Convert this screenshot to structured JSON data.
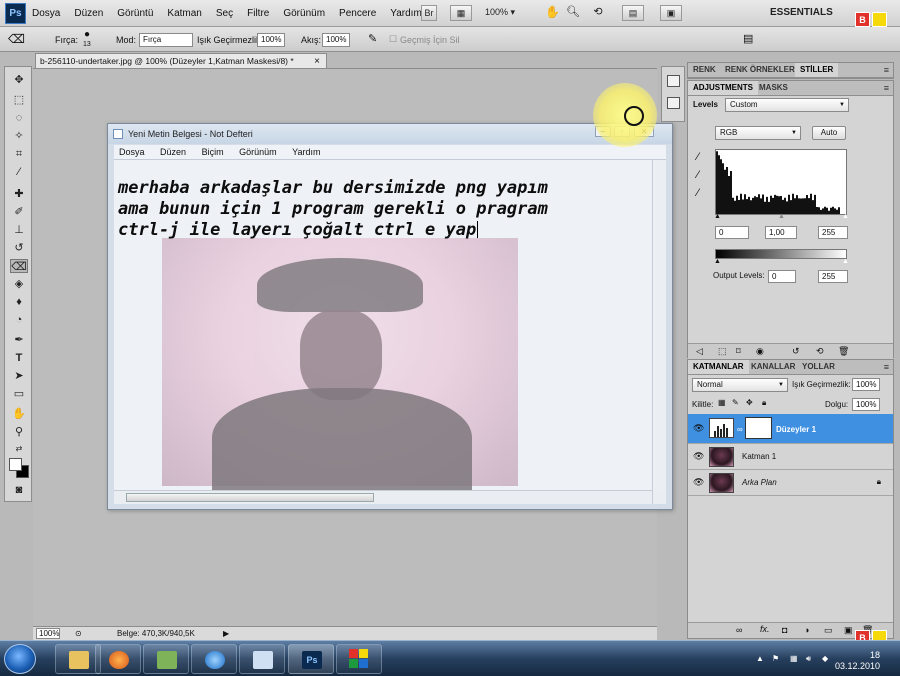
{
  "app": {
    "logo": "Ps",
    "menu": [
      "Dosya",
      "Düzen",
      "Görüntü",
      "Katman",
      "Seç",
      "Filtre",
      "Görünüm",
      "Pencere",
      "Yardım"
    ],
    "zoom": "100%",
    "workspace": "ESSENTIALS",
    "bridge_label": "Br"
  },
  "options": {
    "brush_label": "Fırça:",
    "brush_size": "13",
    "mode_label": "Mod:",
    "mode_value": "Fırça",
    "opacity_label": "Işık Geçirmezlik:",
    "opacity_value": "100%",
    "flow_label": "Akış:",
    "flow_value": "100%",
    "history_label": "Geçmiş İçin Sil"
  },
  "document": {
    "tab_title": "b-256110-undertaker.jpg @ 100% (Düzeyler 1,Katman Maskesi/8) *",
    "close_label": "×",
    "zoom": "100%",
    "doc_size": "Belge: 470,3K/940,5K"
  },
  "notepad": {
    "title": "Yeni Metin Belgesi - Not Defteri",
    "menu": [
      "Dosya",
      "Düzen",
      "Biçim",
      "Görünüm",
      "Yardım"
    ],
    "lines": [
      "merhaba arkadaşlar bu dersimizde png yapım",
      "ama bunun için 1 program gerekli o pragram",
      "ctrl-j ile layerı çoğalt ctrl e yap"
    ]
  },
  "panels": {
    "color_tabs": [
      "RENK",
      "RENK ÖRNEKLERİ",
      "STİLLER"
    ],
    "adj_tabs": [
      "ADJUSTMENTS",
      "MASKS"
    ],
    "levels_label": "Levels",
    "preset_value": "Custom",
    "channel_value": "RGB",
    "auto_label": "Auto",
    "input_black": "0",
    "input_gamma": "1,00",
    "input_white": "255",
    "output_label": "Output Levels:",
    "output_black": "0",
    "output_white": "255",
    "layer_tabs": [
      "KATMANLAR",
      "KANALLAR",
      "YOLLAR"
    ],
    "blend_mode": "Normal",
    "opacity_label": "Işık Geçirmezlik:",
    "opacity_value": "100%",
    "lock_label": "Kilitle:",
    "fill_label": "Dolgu:",
    "fill_value": "100%",
    "layers": [
      "Düzeyler 1",
      "Katman 1",
      "Arka Plan"
    ]
  },
  "taskbar": {
    "clock_time": "18",
    "clock_date": "03.12.2010"
  },
  "colors": {
    "selection": "#3f90e0",
    "tile_b": "#e0312b",
    "tile_y": "#f5d90a",
    "tile_s": "#1e9a3e",
    "tile_r": "#1f6fd0"
  }
}
